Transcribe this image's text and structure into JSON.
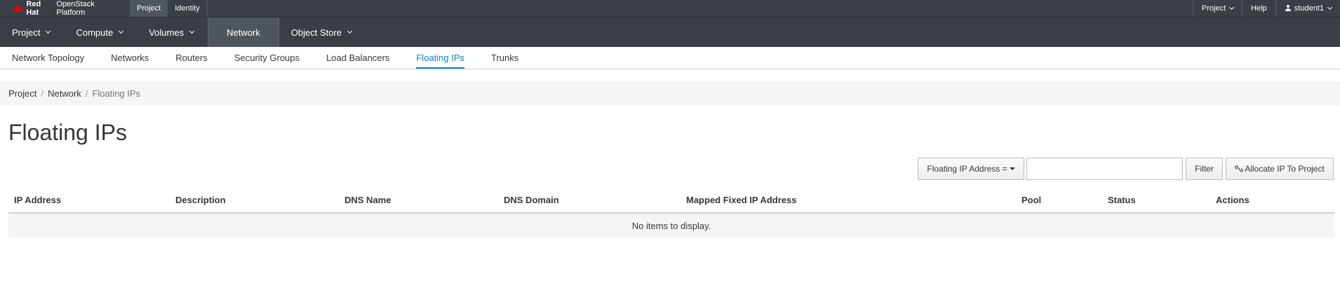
{
  "masthead": {
    "brand_bold": "Red Hat",
    "brand_rest": "OpenStack Platform",
    "dashboard_tabs": [
      "Project",
      "Identity"
    ],
    "right": {
      "project_label": "Project",
      "help_label": "Help",
      "user_label": "student1"
    }
  },
  "primary_nav": [
    "Project",
    "Compute",
    "Volumes",
    "Network",
    "Object Store"
  ],
  "secondary_nav": [
    "Network Topology",
    "Networks",
    "Routers",
    "Security Groups",
    "Load Balancers",
    "Floating IPs",
    "Trunks"
  ],
  "breadcrumb": [
    "Project",
    "Network",
    "Floating IPs"
  ],
  "page_title": "Floating IPs",
  "toolbar": {
    "filter_field_label": "Floating IP Address =",
    "filter_value": "",
    "filter_button": "Filter",
    "allocate_button": "Allocate IP To Project"
  },
  "table": {
    "columns": [
      "IP Address",
      "Description",
      "DNS Name",
      "DNS Domain",
      "Mapped Fixed IP Address",
      "Pool",
      "Status",
      "Actions"
    ],
    "empty_message": "No items to display."
  },
  "colors": {
    "masthead_bg": "#393f44",
    "active_tab_bg": "#4f565b",
    "accent": "#0088ce",
    "brand_red": "#ee0000"
  }
}
